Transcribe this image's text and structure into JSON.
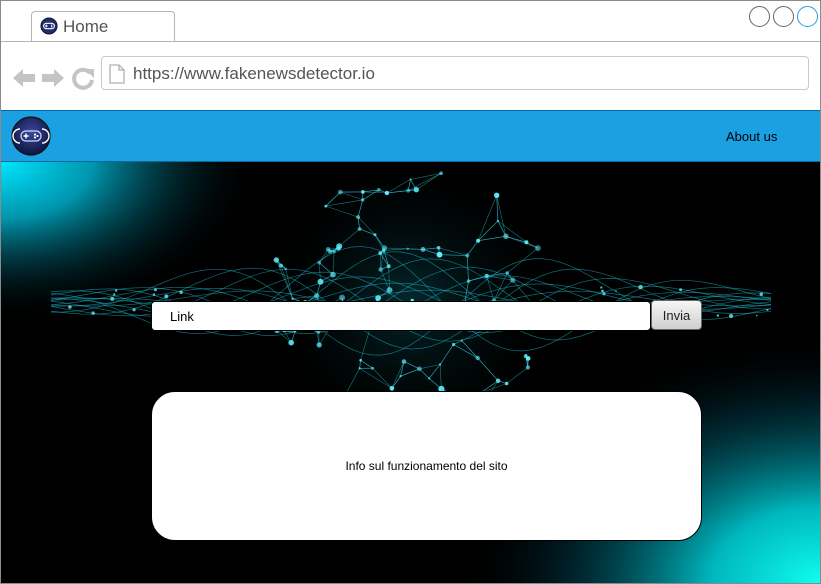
{
  "browser": {
    "tab_title": "Home",
    "url": "https://www.fakenewsdetector.io"
  },
  "header": {
    "logo_icon": "gamepad-logo-icon",
    "nav_about": "About us",
    "background_color": "#1ba1e2"
  },
  "search": {
    "placeholder": "Link",
    "submit_label": "Invia"
  },
  "info": {
    "text": "Info sul funzionamento del sito"
  },
  "colors": {
    "hero_glow": "#00e5ff",
    "hero_background": "#000000"
  }
}
